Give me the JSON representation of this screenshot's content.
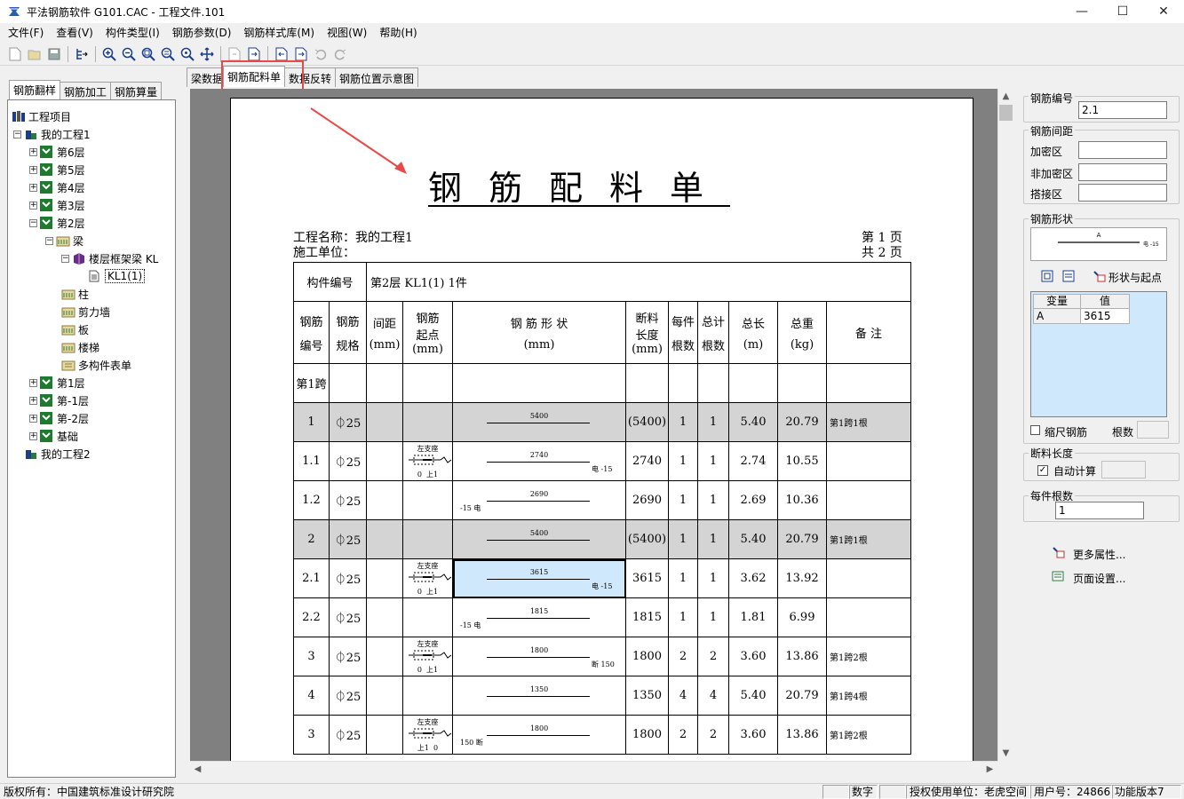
{
  "window": {
    "title": "平法钢筋软件 G101.CAC - 工程文件.101",
    "minimize": "—",
    "maximize": "☐",
    "close": "✕"
  },
  "menu": [
    "文件(F)",
    "查看(V)",
    "构件类型(I)",
    "钢筋参数(D)",
    "钢筋样式库(M)",
    "视图(W)",
    "帮助(H)"
  ],
  "left_tabs": [
    "钢筋翻样",
    "钢筋加工",
    "钢筋算量"
  ],
  "tree": {
    "root": "工程项目",
    "project1": "我的工程1",
    "floor6": "第6层",
    "floor5": "第5层",
    "floor4": "第4层",
    "floor3": "第3层",
    "floor2": "第2层",
    "beam": "梁",
    "frame_beam": "楼层框架梁 KL",
    "kl": "KL1(1)",
    "column": "柱",
    "shear_wall": "剪力墙",
    "slab": "板",
    "stairs": "楼梯",
    "multi": "多构件表单",
    "floor1": "第1层",
    "floor_m1": "第-1层",
    "floor_m2": "第-2层",
    "foundation": "基础",
    "project2": "我的工程2"
  },
  "center_tabs": [
    "梁数据",
    "钢筋配料单",
    "数据反转",
    "钢筋位置示意图"
  ],
  "doc": {
    "title": "钢筋配料单",
    "project_label": "工程名称：我的工程1",
    "unit_label": "施工单位：",
    "page_no": "第  1 页",
    "page_total": "共  2 页",
    "member_label": "构件编号",
    "member_value": "第2层  KL1(1)  1件",
    "headers": {
      "no": [
        "钢筋",
        "编号"
      ],
      "spec": [
        "钢筋",
        "规格"
      ],
      "spacing": [
        "间距",
        "(mm)"
      ],
      "start": [
        "钢筋",
        "起点",
        "(mm)"
      ],
      "shape": [
        "钢  筋  形  状",
        "(mm)"
      ],
      "cut": [
        "断料",
        "长度",
        "(mm)"
      ],
      "per": [
        "每件",
        "根数"
      ],
      "total": [
        "总计",
        "根数"
      ],
      "length": [
        "总长",
        "(m)"
      ],
      "weight": [
        "总重",
        "(kg)"
      ],
      "remark": "备    注"
    },
    "span_label": "第1跨",
    "support_label": "左支座",
    "rows": [
      {
        "no": "1",
        "spec": "⏀25",
        "dim": "5400",
        "cut": "(5400)",
        "per": "1",
        "total": "1",
        "len": "5.40",
        "wt": "20.79",
        "remark": "第1跨1根",
        "gray": true,
        "start": false,
        "left": "",
        "right": ""
      },
      {
        "no": "1.1",
        "spec": "⏀25",
        "dim": "2740",
        "cut": "2740",
        "per": "1",
        "total": "1",
        "len": "2.74",
        "wt": "10.55",
        "remark": "",
        "gray": false,
        "start": true,
        "sx": "0",
        "sy": "上1",
        "left": "",
        "right": "电 -15"
      },
      {
        "no": "1.2",
        "spec": "⏀25",
        "dim": "2690",
        "cut": "2690",
        "per": "1",
        "total": "1",
        "len": "2.69",
        "wt": "10.36",
        "remark": "",
        "gray": false,
        "start": false,
        "left": "-15 电",
        "right": ""
      },
      {
        "no": "2",
        "spec": "⏀25",
        "dim": "5400",
        "cut": "(5400)",
        "per": "1",
        "total": "1",
        "len": "5.40",
        "wt": "20.79",
        "remark": "第1跨1根",
        "gray": true,
        "start": false,
        "left": "",
        "right": ""
      },
      {
        "no": "2.1",
        "spec": "⏀25",
        "dim": "3615",
        "cut": "3615",
        "per": "1",
        "total": "1",
        "len": "3.62",
        "wt": "13.92",
        "remark": "",
        "gray": false,
        "start": true,
        "sx": "0",
        "sy": "上1",
        "left": "",
        "right": "电 -15",
        "sel": true
      },
      {
        "no": "2.2",
        "spec": "⏀25",
        "dim": "1815",
        "cut": "1815",
        "per": "1",
        "total": "1",
        "len": "1.81",
        "wt": "6.99",
        "remark": "",
        "gray": false,
        "start": false,
        "left": "-15 电",
        "right": ""
      },
      {
        "no": "3",
        "spec": "⏀25",
        "dim": "1800",
        "cut": "1800",
        "per": "2",
        "total": "2",
        "len": "3.60",
        "wt": "13.86",
        "remark": "第1跨2根",
        "gray": false,
        "start": true,
        "sx": "0",
        "sy": "上1",
        "left": "",
        "right": "断 150"
      },
      {
        "no": "4",
        "spec": "⏀25",
        "dim": "1350",
        "cut": "1350",
        "per": "4",
        "total": "4",
        "len": "5.40",
        "wt": "20.79",
        "remark": "第1跨4根",
        "gray": false,
        "start": false,
        "left": "",
        "right": ""
      },
      {
        "no": "3",
        "spec": "⏀25",
        "dim": "1800",
        "cut": "1800",
        "per": "2",
        "total": "2",
        "len": "3.60",
        "wt": "13.86",
        "remark": "第1跨2根",
        "gray": false,
        "start": true,
        "sx": "上1",
        "sy": "0",
        "left": "150 断",
        "right": ""
      }
    ]
  },
  "right": {
    "rebar_no_label": "钢筋编号",
    "rebar_no": "2.1",
    "spacing_label": "钢筋间距",
    "dense_label": "加密区",
    "nondense_label": "非加密区",
    "lap_label": "搭接区",
    "shape_label": "钢筋形状",
    "shape_var": "A",
    "shape_note": "电 -15",
    "shape_start_label": "形状与起点",
    "var_header": "变量",
    "val_header": "值",
    "var_name": "A",
    "var_value": "3615",
    "scale_label": "缩尺钢筋",
    "count_label": "根数",
    "cut_len_label": "断料长度",
    "auto_calc_label": "自动计算",
    "per_count_label": "每件根数",
    "per_count": "1",
    "more_props": "更多属性...",
    "page_setup": "页面设置..."
  },
  "status": {
    "copyright": "版权所有：中国建筑标准设计研究院",
    "num": "数字",
    "license": "授权使用单位：老虎空间",
    "user": "用户号：24866",
    "version": "功能版本7"
  },
  "colors": {
    "accent_red": "#e84a4a",
    "selection": "#cfe8fb",
    "gray_row": "#d4d4d4"
  }
}
